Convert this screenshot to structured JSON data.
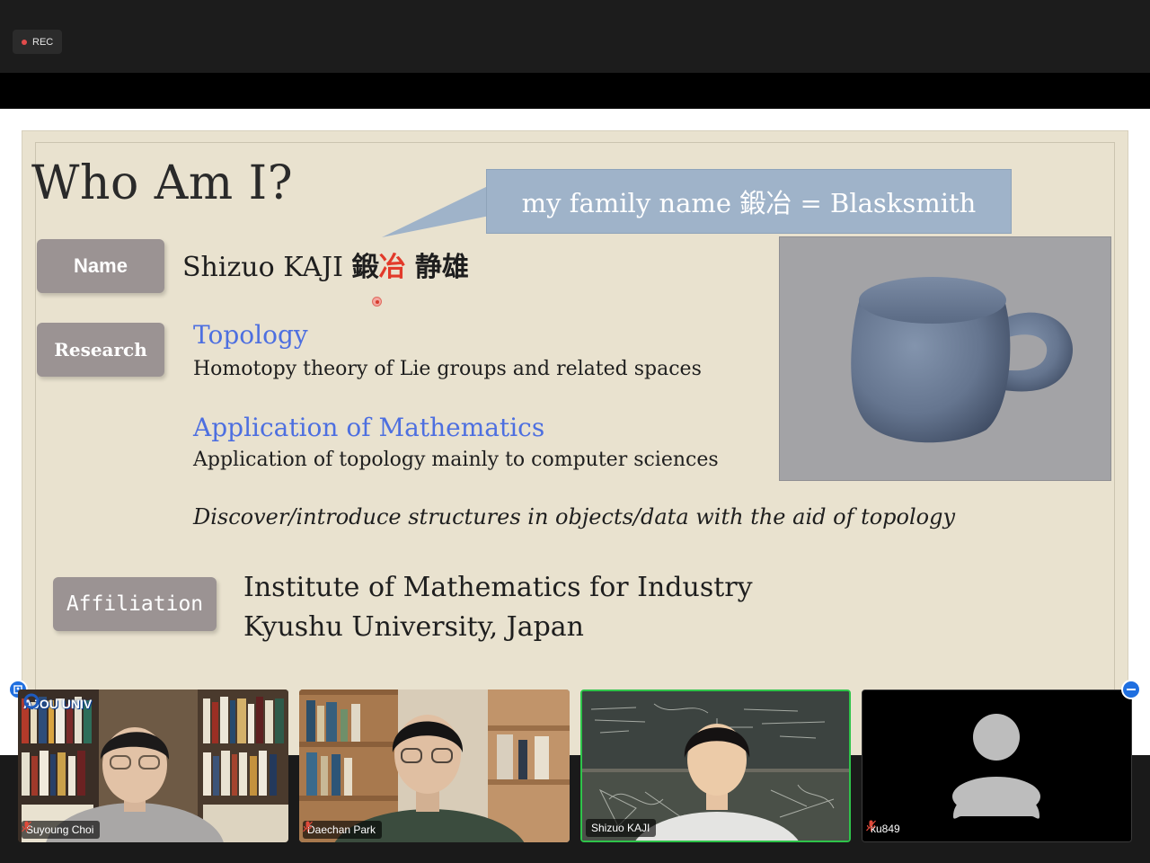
{
  "recording": {
    "label": "REC",
    "dot_color": "#e24b4b"
  },
  "slide": {
    "title": "Who Am I?",
    "callout": "my family name 鍛冶 = Blasksmith",
    "labels": {
      "name": "Name",
      "research": "Research",
      "affiliation": "Affiliation"
    },
    "name_latin": "Shizuo KAJI ",
    "name_kanji_1": "鍛",
    "name_kanji_2": "冶",
    "name_kanji_3": " 静雄",
    "research": [
      {
        "heading": "Topology",
        "text": "Homotopy theory of Lie groups and related spaces"
      },
      {
        "heading": "Application of Mathematics",
        "text": "Application of topology mainly to computer sciences"
      }
    ],
    "motto": "Discover/introduce structures in objects/data with the aid of topology",
    "affiliation_line1": "Institute of Mathematics for Industry",
    "affiliation_line2": "Kyushu University, Japan",
    "image": "mug-torus-render",
    "colors": {
      "label_bg": "#9b9393",
      "link_blue": "#4d6fe0",
      "highlight_red": "#e23a2a",
      "slide_bg": "#e9e2cf",
      "callout_bg": "#9fb3c9"
    }
  },
  "participants": [
    {
      "name": "Suyoung Choi",
      "muted": true,
      "overlay": "AJOU UNIV"
    },
    {
      "name": "Daechan Park",
      "muted": true
    },
    {
      "name": "Shizuo KAJI",
      "muted": false,
      "active_speaker": true,
      "speaker_border": "#2ec44a"
    },
    {
      "name": "ku849",
      "muted": true,
      "video_off": true
    }
  ],
  "controls": {
    "left_icon": "share-view-icon",
    "right_icon": "minimize-icon"
  }
}
